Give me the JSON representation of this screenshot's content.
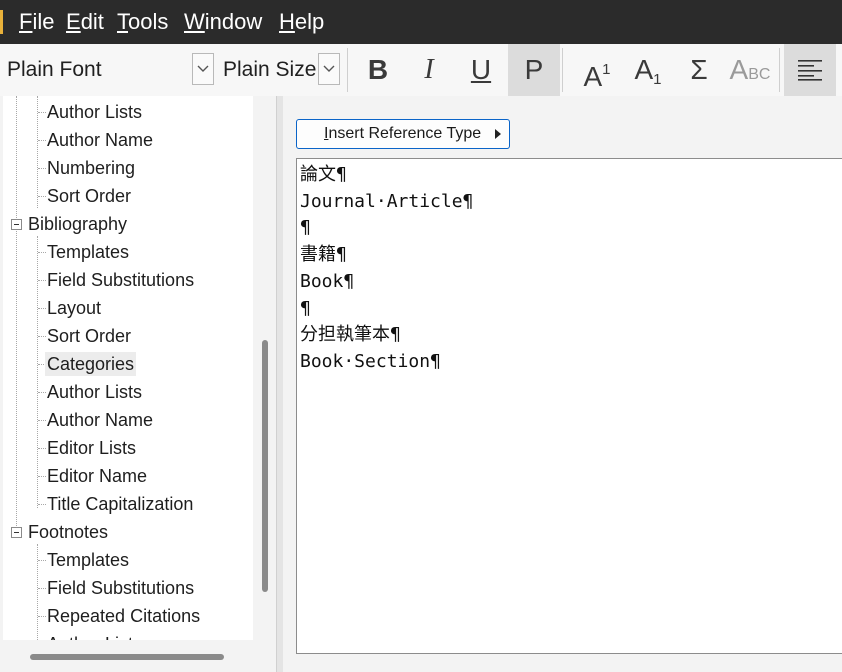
{
  "menu": {
    "items": [
      {
        "key": "F",
        "rest": "ile"
      },
      {
        "key": "E",
        "rest": "dit"
      },
      {
        "key": "T",
        "rest": "ools"
      },
      {
        "key": "W",
        "rest": "indow"
      },
      {
        "key": "H",
        "rest": "elp"
      }
    ]
  },
  "toolbar": {
    "font_value": "Plain Font",
    "size_value": "Plain Size",
    "bold_label": "B",
    "italic_label": "I",
    "underline_label": "U",
    "plain_label": "P",
    "superscript_base": "A",
    "superscript_mark": "1",
    "subscript_base": "A",
    "subscript_mark": "1",
    "symbol_label": "Σ",
    "smallcaps_big": "A",
    "smallcaps_small": "BC",
    "plain_pressed": true
  },
  "tree": {
    "items": [
      {
        "label": "Author Lists",
        "level": 1
      },
      {
        "label": "Author Name",
        "level": 1
      },
      {
        "label": "Numbering",
        "level": 1
      },
      {
        "label": "Sort Order",
        "level": 1
      },
      {
        "label": "Bibliography",
        "level": 0,
        "expanded": true
      },
      {
        "label": "Templates",
        "level": 1
      },
      {
        "label": "Field Substitutions",
        "level": 1
      },
      {
        "label": "Layout",
        "level": 1
      },
      {
        "label": "Sort Order",
        "level": 1
      },
      {
        "label": "Categories",
        "level": 1,
        "selected": true
      },
      {
        "label": "Author Lists",
        "level": 1
      },
      {
        "label": "Author Name",
        "level": 1
      },
      {
        "label": "Editor Lists",
        "level": 1
      },
      {
        "label": "Editor Name",
        "level": 1
      },
      {
        "label": "Title Capitalization",
        "level": 1
      },
      {
        "label": "Footnotes",
        "level": 0,
        "expanded": true
      },
      {
        "label": "Templates",
        "level": 1
      },
      {
        "label": "Field Substitutions",
        "level": 1
      },
      {
        "label": "Repeated Citations",
        "level": 1
      },
      {
        "label": "Author Lists",
        "level": 1
      }
    ]
  },
  "editor": {
    "insert_button_label": "Insert Reference Type",
    "insert_button_key": "I",
    "lines": [
      "論文¶",
      "Journal·Article¶",
      "¶",
      "書籍¶",
      "Book¶",
      "¶",
      "分担執筆本¶",
      "Book·Section¶"
    ]
  },
  "colors": {
    "menubar_bg": "#2b2b2b",
    "accent": "#e8b13a",
    "button_border": "#0a64c8",
    "selected_bg": "#ececec"
  }
}
